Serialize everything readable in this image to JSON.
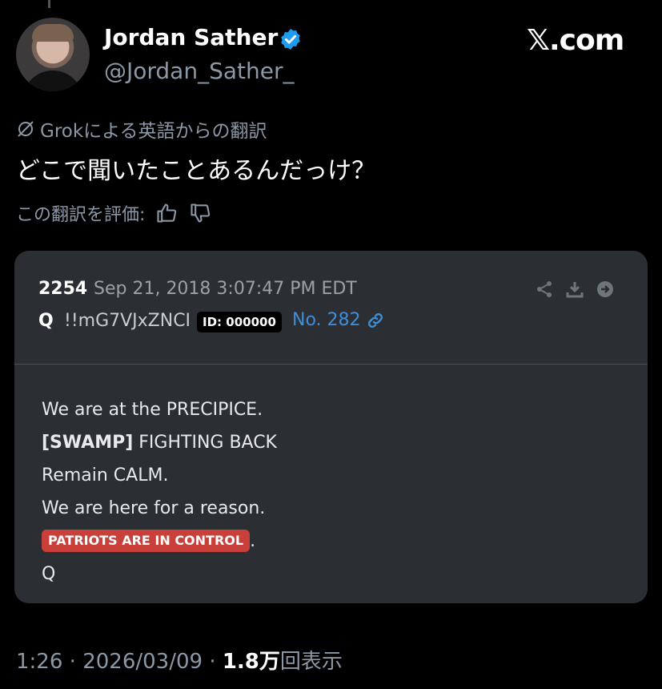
{
  "author": {
    "name": "Jordan Sather",
    "handle": "@Jordan_Sather_"
  },
  "brand": "𝕏.com",
  "translation": {
    "source_label": "Grokによる英語からの翻訳",
    "text": "どこで聞いたことあるんだっけ？",
    "rate_label": "この翻訳を評価:"
  },
  "quoted_post": {
    "number": "2254",
    "date": "Sep 21, 2018 3:07:47 PM EDT",
    "poster": "Q",
    "tripcode": "!!mG7VJxZNCI",
    "id_badge": "ID: 000000",
    "post_no": "No. 282",
    "lines": [
      "We are at the PRECIPICE.",
      "[SWAMP]",
      "FIGHTING BACK",
      "Remain CALM.",
      "We are here for a reason.",
      "PATRIOTS ARE IN CONTROL",
      ".",
      "Q"
    ]
  },
  "footer": {
    "time": "1:26",
    "sep": "·",
    "date": "2026/03/09",
    "views": "1.8",
    "views_unit": "万",
    "views_label": "回表示"
  },
  "colors": {
    "background": "#000000",
    "card": "#2b2f33",
    "verified": "#1d9bf0",
    "link": "#3f8ed8",
    "pill": "#c9403a"
  }
}
